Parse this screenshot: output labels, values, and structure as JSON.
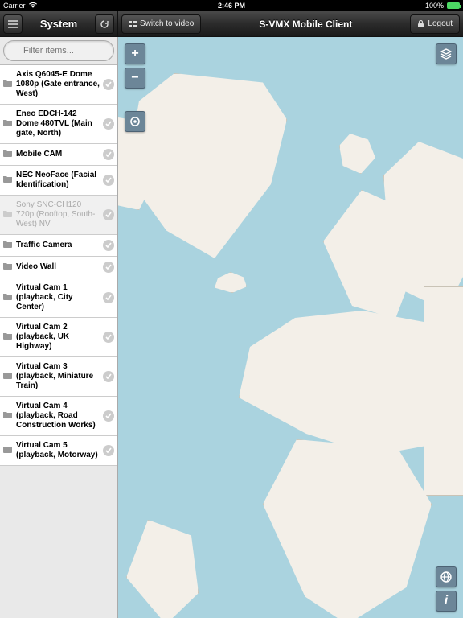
{
  "status": {
    "carrier": "Carrier",
    "time": "2:46 PM",
    "battery_pct": "100%"
  },
  "header": {
    "left_title": "System",
    "switch_label": "Switch to video",
    "app_title": "S-VMX Mobile Client",
    "logout_label": "Logout"
  },
  "sidebar": {
    "filter_placeholder": "Filter items...",
    "items": [
      {
        "label": "Axis Q6045-E Dome 1080p (Gate entrance, West)",
        "disabled": false
      },
      {
        "label": "Eneo EDCH-142 Dome 480TVL (Main gate, North)",
        "disabled": false
      },
      {
        "label": "Mobile CAM",
        "disabled": false
      },
      {
        "label": "NEC NeoFace (Facial Identification)",
        "disabled": false
      },
      {
        "label": "Sony SNC-CH120 720p (Rooftop, South-West) NV",
        "disabled": true
      },
      {
        "label": "Traffic Camera",
        "disabled": false
      },
      {
        "label": "Video Wall",
        "disabled": false
      },
      {
        "label": "Virtual Cam 1 (playback, City Center)",
        "disabled": false
      },
      {
        "label": "Virtual Cam 2 (playback, UK Highway)",
        "disabled": false
      },
      {
        "label": "Virtual Cam 3 (playback, Miniature Train)",
        "disabled": false
      },
      {
        "label": "Virtual Cam 4 (playback, Road Construction Works)",
        "disabled": false
      },
      {
        "label": "Virtual Cam 5 (playback, Motorway)",
        "disabled": false
      }
    ]
  },
  "map": {
    "zoom_in": "+",
    "zoom_out": "−"
  },
  "colors": {
    "water": "#aad3df",
    "land": "#f3efe8",
    "control": "#6c8698"
  }
}
